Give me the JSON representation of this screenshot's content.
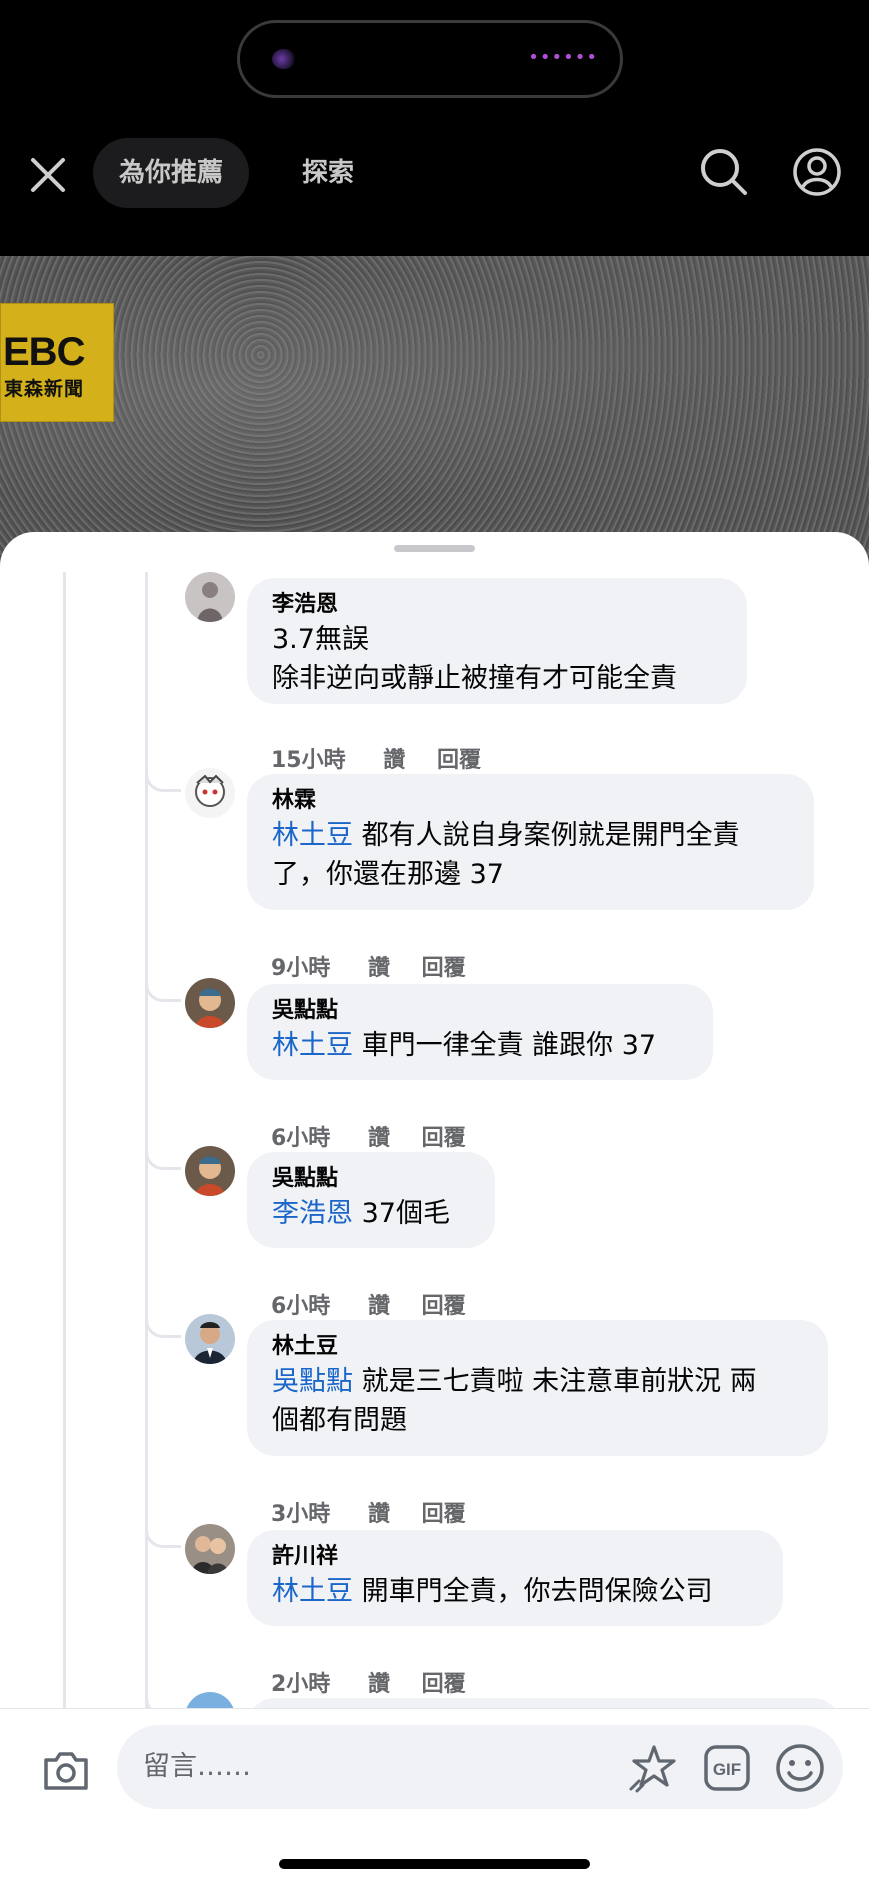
{
  "topbar": {
    "tab_recommended": "為你推薦",
    "tab_explore": "探索"
  },
  "video": {
    "logo_big": "EBC",
    "logo_small": "東森新聞"
  },
  "comments": [
    {
      "author": "李浩恩",
      "mention": "",
      "text_lines": [
        "3.7無誤",
        "除非逆向或靜止被撞有才可能全責"
      ],
      "time": "15小時",
      "like": "讚",
      "reply": "回覆"
    },
    {
      "author": "林霖",
      "mention": "林土豆",
      "text": " 都有人說自身案例就是開門全責",
      "text2": "了，你還在那邊 37",
      "time": "9小時",
      "like": "讚",
      "reply": "回覆"
    },
    {
      "author": "吳點點",
      "mention": "林土豆",
      "text": " 車門一律全責 誰跟你 37",
      "time": "6小時",
      "like": "讚",
      "reply": "回覆"
    },
    {
      "author": "吳點點",
      "mention": "李浩恩",
      "text": " 37個毛",
      "time": "6小時",
      "like": "讚",
      "reply": "回覆"
    },
    {
      "author": "林土豆",
      "mention": "吳點點",
      "text": " 就是三七責啦 未注意車前狀況 兩",
      "text2": "個都有問題",
      "time": "3小時",
      "like": "讚",
      "reply": "回覆"
    },
    {
      "author": "許川祥",
      "mention": "林土豆",
      "text": " 開車門全責，你去問保險公司",
      "time": "2小時",
      "like": "讚",
      "reply": "回覆"
    }
  ],
  "composer": {
    "placeholder": "留言……"
  },
  "colors": {
    "mention": "#1b66c9",
    "bubble": "#f0f2f5",
    "meta": "#65676b"
  }
}
